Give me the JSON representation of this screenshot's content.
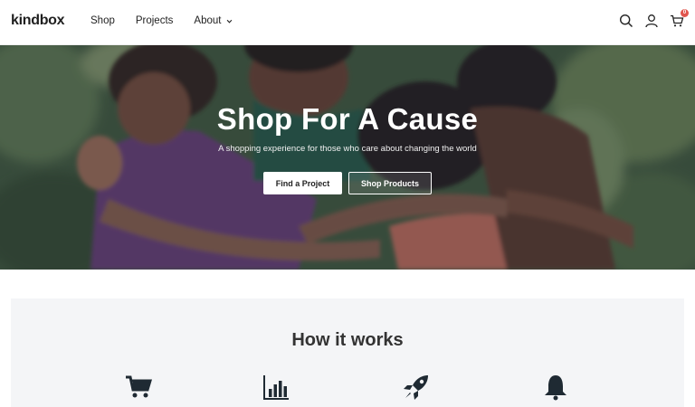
{
  "brand": {
    "name": "kindbox"
  },
  "nav": {
    "items": [
      {
        "label": "Shop"
      },
      {
        "label": "Projects"
      },
      {
        "label": "About",
        "has_dropdown": true
      }
    ]
  },
  "header_icons": {
    "search": "search-icon",
    "account": "user-icon",
    "cart": "cart-icon",
    "cart_count": "0"
  },
  "hero": {
    "title": "Shop For A Cause",
    "subtitle": "A shopping experience for those who care about changing the world",
    "primary_button": "Find a Project",
    "secondary_button": "Shop Products"
  },
  "how_it_works": {
    "title": "How it works",
    "icons": [
      "shopping-cart-icon",
      "bar-chart-icon",
      "rocket-icon",
      "bell-icon"
    ]
  },
  "colors": {
    "badge": "#e0554d",
    "section_bg": "#f4f5f7"
  }
}
